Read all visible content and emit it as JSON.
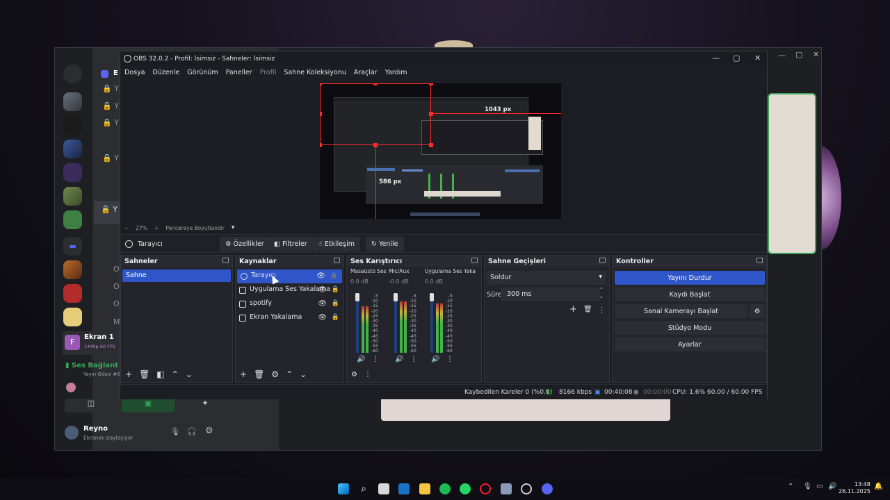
{
  "discord": {
    "server_initial": "E",
    "channel_letters": [
      "Y",
      "Y",
      "Y",
      "Y",
      "Y",
      "O",
      "O",
      "O",
      "M"
    ],
    "stream_card": {
      "initial": "F",
      "title": "Ekran 1",
      "meta": "1440p 60 FPS"
    },
    "voice": {
      "status": "Ses Bağlant",
      "room": "Yayın Odası #6"
    },
    "user": {
      "name": "Reyno",
      "status": "Ekranını paylaşıyor"
    }
  },
  "obs": {
    "title": "OBS 32.0.2 - Profil: İsimsiz - Sahneler: İsimsiz",
    "menu": [
      "Dosya",
      "Düzenle",
      "Görünüm",
      "Paneller",
      "Profil",
      "Sahne Koleksiyonu",
      "Araçlar",
      "Yardım"
    ],
    "menu_disabled": "Profil",
    "preview": {
      "width_label": "1043 px",
      "height_label": "586 px"
    },
    "zoom": {
      "minus": "−",
      "percent": "27%",
      "plus": "+",
      "fit": "Pencereye Boyutlandır",
      "dropdown": "▾"
    },
    "source_toolbar": {
      "selected_source": "Tarayıcı",
      "properties": "Özellikler",
      "filters": "Filtreler",
      "interact": "Etkileşim",
      "refresh": "Yenile"
    },
    "scenes": {
      "title": "Sahneler",
      "items": [
        "Sahne"
      ]
    },
    "sources": {
      "title": "Kaynaklar",
      "items": [
        "Tarayıcı",
        "Uygulama Ses Yakalama",
        "spotify",
        "Ekran Yakalama"
      ]
    },
    "mixer": {
      "title": "Ses Karıştırıcı",
      "channels": [
        {
          "name": "Masaüstü Ses",
          "db": "0.0 dB",
          "level": 0.82
        },
        {
          "name": "Mic/Aux",
          "db": "-0.0 dB",
          "level": 0.9
        },
        {
          "name": "Uygulama Ses Yaka",
          "db": "0.0 dB",
          "level": 0.86
        }
      ],
      "scale": [
        "-5",
        "-10",
        "-15",
        "-20",
        "-25",
        "-30",
        "-35",
        "-40",
        "-45",
        "-50",
        "-55",
        "-60"
      ]
    },
    "transitions": {
      "title": "Sahne Geçişleri",
      "selected": "Soldur",
      "duration_label": "Süre",
      "duration_value": "300 ms"
    },
    "controls": {
      "title": "Kontroller",
      "stop_stream": "Yayını Durdur",
      "start_record": "Kaydı Başlat",
      "virtual_cam": "Sanal Kamerayı Başlat",
      "studio_mode": "Stüdyo Modu",
      "settings": "Ayarlar"
    },
    "status": {
      "dropped": "Kaybedilen Kareler 0 (%0.0)",
      "bitrate": "8166 kbps",
      "live_time": "00:40:08",
      "rec_time": "00:00:00",
      "cpu": "CPU: 1.6%",
      "fps": "60.00 / 60.00 FPS"
    }
  },
  "taskbar": {
    "time": "13:48",
    "date": "26.11.2025"
  },
  "colors": {
    "accent": "#2f56c9",
    "selection": "#ff2a2a",
    "meter_green": "#41b34a"
  }
}
